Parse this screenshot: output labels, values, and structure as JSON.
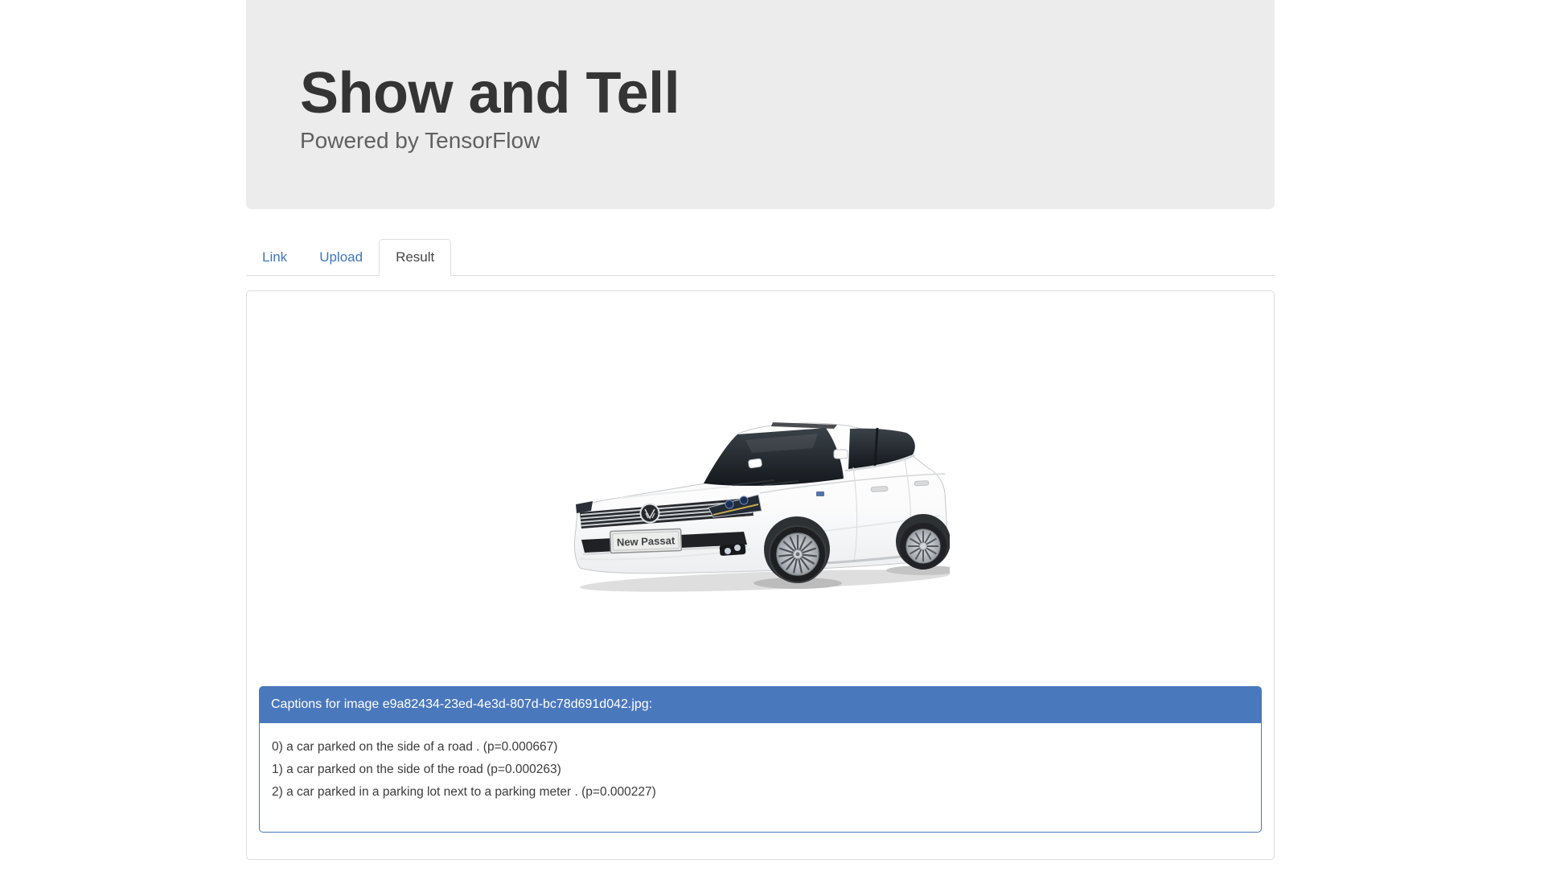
{
  "header": {
    "title": "Show and Tell",
    "subtitle": "Powered by TensorFlow"
  },
  "tabs": [
    {
      "label": "Link",
      "active": false
    },
    {
      "label": "Upload",
      "active": false
    },
    {
      "label": "Result",
      "active": true
    }
  ],
  "result": {
    "image": {
      "plate_label": "New Passat"
    },
    "captions_header": "Captions for image e9a82434-23ed-4e3d-807d-bc78d691d042.jpg:",
    "captions": [
      "0) a car parked on the side of a road . (p=0.000667)",
      "1) a car parked on the side of the road (p=0.000263)",
      "2) a car parked in a parking lot next to a parking meter . (p=0.000227)"
    ]
  },
  "colors": {
    "accent_blue": "#4a78bd",
    "link_blue": "#3d76c2",
    "jumbotron_bg": "#ececec",
    "border_gray": "#dddddd",
    "title_text": "#343434",
    "subtitle_text": "#606060"
  }
}
